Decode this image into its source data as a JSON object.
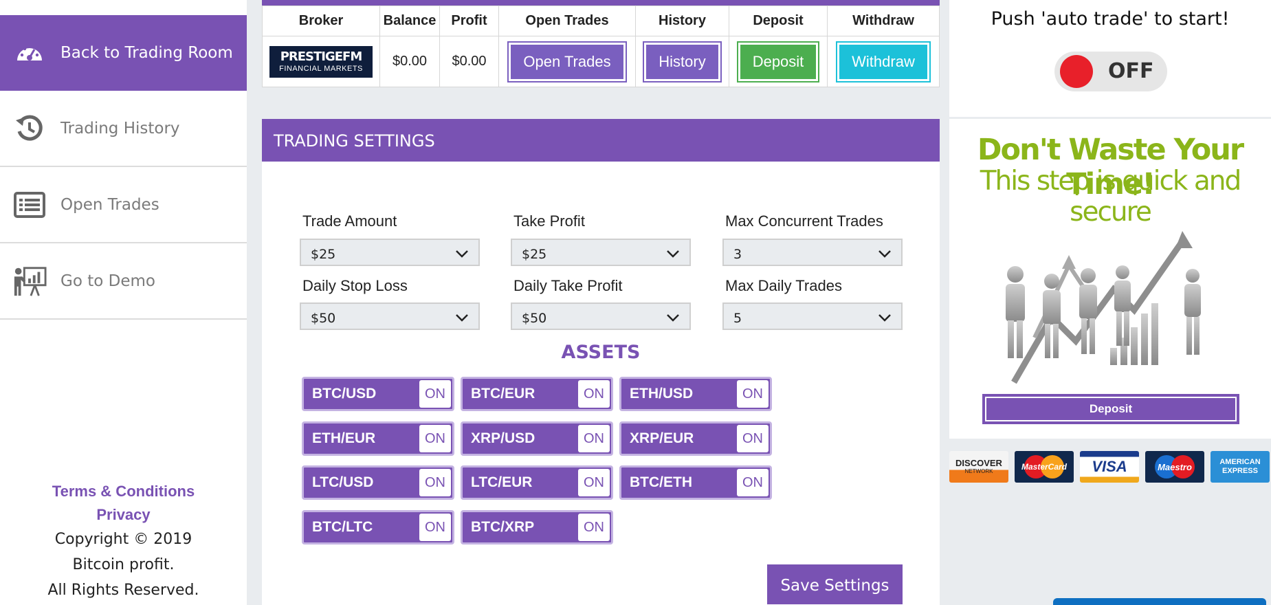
{
  "sidebar": {
    "items": [
      {
        "label": "Back to Trading Room",
        "icon": "dashboard-gauge-icon",
        "active": true
      },
      {
        "label": "Trading History",
        "icon": "history-icon",
        "active": false
      },
      {
        "label": "Open Trades",
        "icon": "list-icon",
        "active": false
      },
      {
        "label": "Go to Demo",
        "icon": "presentation-icon",
        "active": false
      }
    ],
    "footer": {
      "terms": "Terms & Conditions",
      "privacy": "Privacy",
      "copyright": "Copyright © 2019",
      "company": "Bitcoin profit.",
      "rights": "All Rights Reserved."
    }
  },
  "broker_table": {
    "headers": [
      "Broker",
      "Balance",
      "Profit",
      "Open Trades",
      "History",
      "Deposit",
      "Withdraw"
    ],
    "broker_logo_line1": "PRESTIGEFM",
    "broker_logo_line2": "FINANCIAL MARKETS",
    "balance": "$0.00",
    "profit": "$0.00",
    "buttons": {
      "open_trades": "Open Trades",
      "history": "History",
      "deposit": "Deposit",
      "withdraw": "Withdraw"
    }
  },
  "settings": {
    "title": "TRADING SETTINGS",
    "fields": [
      {
        "label": "Trade Amount",
        "value": "$25"
      },
      {
        "label": "Take Profit",
        "value": "$25"
      },
      {
        "label": "Max Concurrent Trades",
        "value": "3"
      },
      {
        "label": "Daily Stop Loss",
        "value": "$50"
      },
      {
        "label": "Daily Take Profit",
        "value": "$50"
      },
      {
        "label": "Max Daily Trades",
        "value": "5"
      }
    ],
    "assets_title": "ASSETS",
    "assets": [
      {
        "name": "BTC/USD",
        "state": "ON"
      },
      {
        "name": "BTC/EUR",
        "state": "ON"
      },
      {
        "name": "ETH/USD",
        "state": "ON"
      },
      {
        "name": "ETH/EUR",
        "state": "ON"
      },
      {
        "name": "XRP/USD",
        "state": "ON"
      },
      {
        "name": "XRP/EUR",
        "state": "ON"
      },
      {
        "name": "LTC/USD",
        "state": "ON"
      },
      {
        "name": "LTC/EUR",
        "state": "ON"
      },
      {
        "name": "BTC/ETH",
        "state": "ON"
      },
      {
        "name": "BTC/LTC",
        "state": "ON"
      },
      {
        "name": "BTC/XRP",
        "state": "ON"
      }
    ],
    "save_label": "Save Settings"
  },
  "autotrade": {
    "prompt": "Push 'auto trade' to start!",
    "state": "OFF"
  },
  "ad": {
    "title": "Don't Waste Your Time!",
    "subtitle": "This step is quick and secure",
    "deposit_label": "Deposit"
  },
  "payment_cards": [
    {
      "name": "DISCOVER",
      "sub": "NETWORK"
    },
    {
      "name": "MasterCard"
    },
    {
      "name": "VISA"
    },
    {
      "name": "Maestro"
    },
    {
      "name": "AMERICAN",
      "sub": "EXPRESS"
    }
  ],
  "colors": {
    "accent": "#7952b3",
    "deposit_green": "#4cae4f",
    "withdraw_cyan": "#1cc1d9",
    "toggle_red": "#e8202a",
    "ad_green": "#8bb51a"
  }
}
